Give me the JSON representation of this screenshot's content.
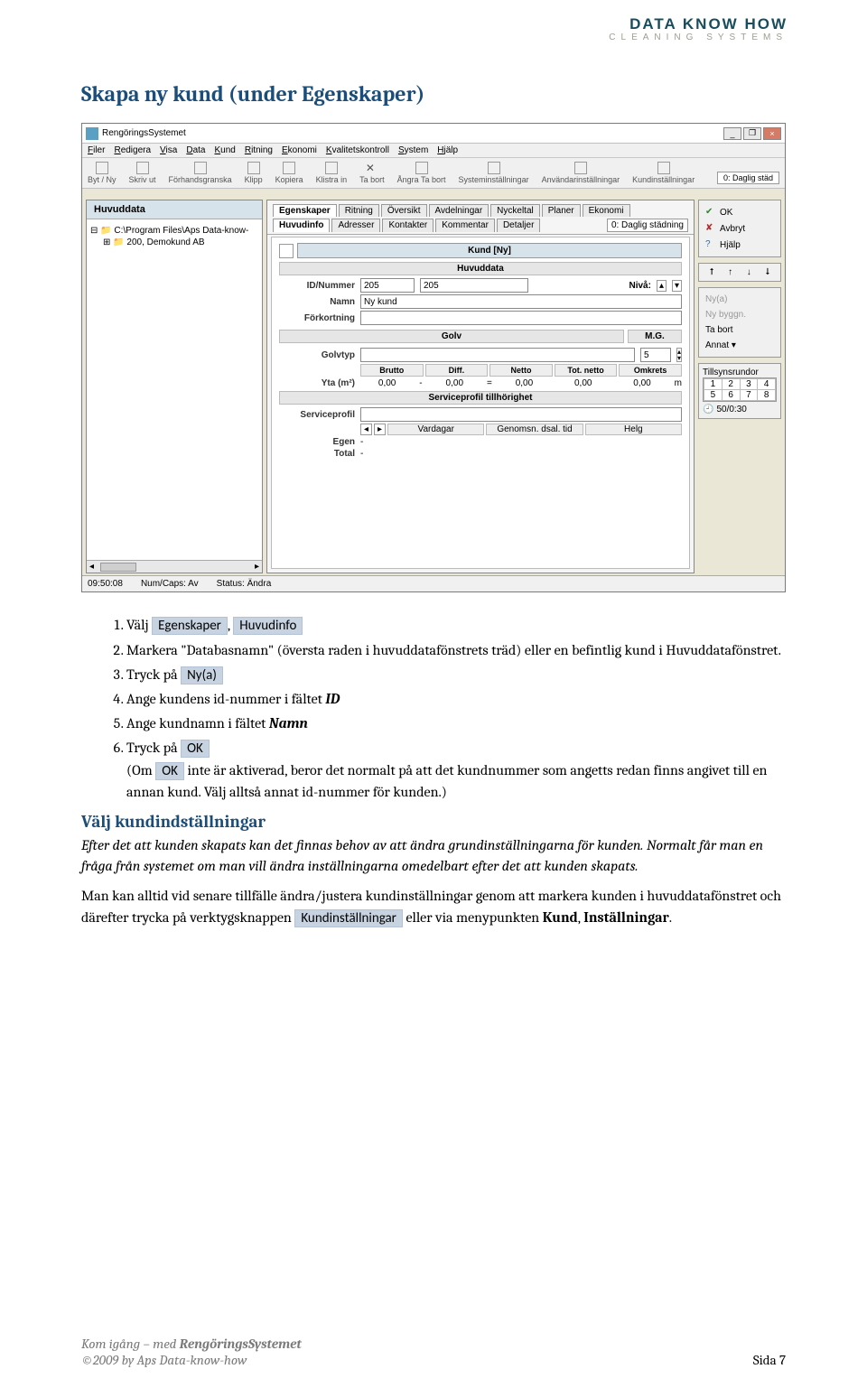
{
  "logo": {
    "top": "DATA KNOW HOW",
    "bottom": "CLEANING SYSTEMS"
  },
  "title": "Skapa ny kund (under Egenskaper)",
  "app": {
    "window_title": "RengöringsSystemet",
    "menubar": [
      "Filer",
      "Redigera",
      "Visa",
      "Data",
      "Kund",
      "Ritning",
      "Ekonomi",
      "Kvalitetskontroll",
      "System",
      "Hjälp"
    ],
    "toolbar": [
      "Byt / Ny",
      "Skriv ut",
      "Förhandsgranska",
      "Klipp",
      "Kopiera",
      "Klistra in",
      "Ta bort",
      "Ångra Ta bort",
      "Systeminställningar",
      "Användarinställningar",
      "Kundinställningar"
    ],
    "toolbar_right": "0: Daglig städ",
    "tree": {
      "header": "Huvuddata",
      "root": "C:\\Program Files\\Aps Data-know-",
      "node": "200, Demokund AB"
    },
    "tabs_main": [
      "Egenskaper",
      "Ritning",
      "Översikt",
      "Avdelningar",
      "Nyckeltal",
      "Planer",
      "Ekonomi"
    ],
    "tabs_sub": [
      "Huvudinfo",
      "Adresser",
      "Kontakter",
      "Kommentar",
      "Detaljer"
    ],
    "header_right": "0: Daglig städning",
    "form": {
      "title": "Kund [Ny]",
      "section_huvuddata": "Huvuddata",
      "id_label": "ID/Nummer",
      "id1": "205",
      "id2": "205",
      "niva_label": "Nivå:",
      "namn_label": "Namn",
      "namn_value": "Ny kund",
      "forkortning_label": "Förkortning",
      "section_golv": "Golv",
      "golv_mg": "M.G.",
      "golvtyp_label": "Golvtyp",
      "golv_spin": "5",
      "yta_label": "Yta (m²)",
      "col_brutto": "Brutto",
      "col_diff": "Diff.",
      "col_netto": "Netto",
      "col_totnetto": "Tot. netto",
      "col_omkrets": "Omkrets",
      "yta_v": "0,00",
      "yta_unit": "m",
      "section_service": "Serviceprofil tillhörighet",
      "serviceprofil_label": "Serviceprofil",
      "sp_cols": [
        "Vardagar",
        "Genomsn. dsal. tid",
        "Helg"
      ],
      "egen_label": "Egen",
      "total_label": "Total",
      "minus": "-"
    },
    "side": {
      "ok": "OK",
      "avbryt": "Avbryt",
      "hjalp": "Hjälp",
      "nya": "Ny(a)",
      "nybyggn": "Ny byggn.",
      "tabort": "Ta bort",
      "annat": "Annat ▾",
      "tillsynsrundor": "Tillsynsrundor",
      "grid": [
        "1",
        "2",
        "3",
        "4",
        "5",
        "6",
        "7",
        "8"
      ],
      "clock": "50/0:30"
    },
    "statusbar": {
      "time": "09:50:08",
      "caps": "Num/Caps: Av",
      "status": "Status: Ändra"
    }
  },
  "steps": {
    "s1a": "Välj ",
    "s1_b1": "Egenskaper",
    "s1_comma": ", ",
    "s1_b2": "Huvudinfo",
    "s2": "Markera \"Databasnamn\" (översta raden i huvuddatafönstrets träd) eller en befintlig kund i Huvuddatafönstret.",
    "s3a": "Tryck på ",
    "s3_b": "Ny(a)",
    "s4a": "Ange kundens id-nummer i fältet ",
    "s4_bold": "ID",
    "s5a": "Ange kundnamn i fältet ",
    "s5_bold": "Namn",
    "s6a": "Tryck på ",
    "s6_b": "OK",
    "s6_par_a": "(Om ",
    "s6_par_b": "OK",
    "s6_par_c": " inte är aktiverad, beror det normalt på att det kundnummer som angetts redan finns angivet till en annan kund. Välj alltså annat id-nummer för kunden.)"
  },
  "h2": "Välj kundindställningar",
  "para1": "Efter det att kunden skapats kan det finnas behov av att ändra grundinställningarna för kunden. Normalt får man en fråga från systemet om man vill ändra inställningarna omedelbart efter det att kunden skapats.",
  "para2_a": "Man kan alltid vid senare tillfälle ändra/justera kundinställningar genom att markera kunden i huvuddatafönstret och därefter trycka på verktygsknappen ",
  "para2_btn": "Kundinställningar",
  "para2_b": " eller via menypunkten ",
  "para2_bold1": "Kund",
  "para2_comma": ", ",
  "para2_bold2": "Inställningar",
  "para2_end": ".",
  "footer": {
    "l1": "Kom igång – med ",
    "l1b": "RengöringsSystemet",
    "l2": "©2009 by Aps Data-know-how",
    "pg": "Sida 7"
  }
}
